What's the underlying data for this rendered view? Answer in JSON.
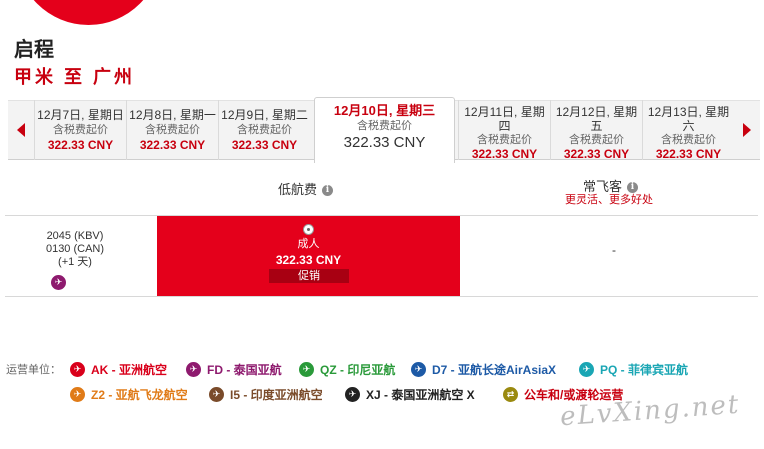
{
  "header": {
    "title": "启程",
    "route": "甲米 至 广州"
  },
  "datebar": {
    "prev_label": "◀",
    "next_label": "▶",
    "dates": [
      {
        "day": "12月7日, 星期日",
        "tax": "含税费起价",
        "price": "322.33 CNY"
      },
      {
        "day": "12月8日, 星期一",
        "tax": "含税费起价",
        "price": "322.33 CNY"
      },
      {
        "day": "12月9日, 星期二",
        "tax": "含税费起价",
        "price": "322.33 CNY"
      },
      {
        "day": "12月10日, 星期三",
        "tax": "含税费起价",
        "price": "322.33 CNY"
      },
      {
        "day": "12月11日, 星期四",
        "tax": "含税费起价",
        "price": "322.33 CNY"
      },
      {
        "day": "12月12日, 星期五",
        "tax": "含税费起价",
        "price": "322.33 CNY"
      },
      {
        "day": "12月13日, 星期六",
        "tax": "含税费起价",
        "price": "322.33 CNY"
      }
    ]
  },
  "fare_columns": {
    "low_fare": "低航费",
    "frequent_flyer": "常飞客",
    "frequent_flyer_sub": "更灵活、更多好处",
    "info_glyph": "i"
  },
  "flight": {
    "depart": "2045 (KBV)",
    "arrive": "0130 (CAN)",
    "day_offset": "(+1 天)",
    "logo_icon": "fd-airline-icon",
    "low_fare_cell": {
      "pax": "成人",
      "price": "322.33 CNY",
      "promo": "促销"
    },
    "flyer_cell": "-"
  },
  "operators": {
    "label": "运营单位：",
    "items": [
      {
        "code": "AK - 亚洲航空",
        "color": "#d9001b",
        "icon": "ak-icon"
      },
      {
        "code": "FD - 泰国亚航",
        "color": "#8e1a6e",
        "icon": "fd-icon"
      },
      {
        "code": "QZ - 印尼亚航",
        "color": "#2a9a3a",
        "icon": "qz-icon"
      },
      {
        "code": "D7 - 亚航长途AirAsiaX",
        "color": "#1d5aa6",
        "icon": "d7-icon"
      },
      {
        "code": "PQ - 菲律宾亚航",
        "color": "#1aa6b4",
        "icon": "pq-icon"
      },
      {
        "code": "Z2 - 亚航飞龙航空",
        "color": "#e07b18",
        "icon": "z2-icon"
      },
      {
        "code": "I5 - 印度亚洲航空",
        "color": "#7a4b2a",
        "icon": "i5-icon"
      },
      {
        "code": "XJ - 泰国亚洲航空 X",
        "color": "#222222",
        "icon": "xj-icon"
      },
      {
        "code": "公车和/或渡轮运营",
        "color": "#9a8a10",
        "icon": "bus-ferry-icon"
      }
    ]
  },
  "watermark": "eLvXing.net"
}
